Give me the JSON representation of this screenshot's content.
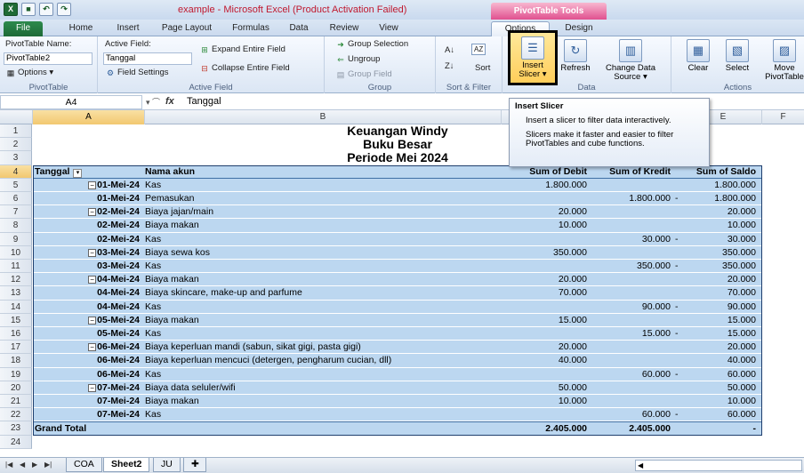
{
  "window": {
    "title": "example - Microsoft Excel (Product Activation Failed)",
    "context_tab_group": "PivotTable Tools"
  },
  "tabs": [
    "File",
    "Home",
    "Insert",
    "Page Layout",
    "Formulas",
    "Data",
    "Review",
    "View",
    "Options",
    "Design"
  ],
  "ribbon": {
    "pivottable": {
      "name_label": "PivotTable Name:",
      "name_value": "PivotTable2",
      "options_label": "Options",
      "group_label": "PivotTable"
    },
    "active_field": {
      "label": "Active Field:",
      "value": "Tanggal",
      "field_settings": "Field Settings",
      "expand": "Expand Entire Field",
      "collapse": "Collapse Entire Field",
      "group_label": "Active Field"
    },
    "group": {
      "selection": "Group Selection",
      "ungroup": "Ungroup",
      "group_field": "Group Field",
      "group_label": "Group"
    },
    "sort": {
      "sort_label": "Sort",
      "group_label": "Sort & Filter"
    },
    "insert_slicer": {
      "line1": "Insert",
      "line2": "Slicer"
    },
    "data": {
      "refresh": "Refresh",
      "change_source1": "Change Data",
      "change_source2": "Source",
      "group_label": "Data"
    },
    "actions": {
      "clear": "Clear",
      "select": "Select",
      "move1": "Move",
      "move2": "PivotTable",
      "group_label": "Actions"
    }
  },
  "formula_bar": {
    "name_box": "A4",
    "fx": "fx",
    "content": "Tanggal"
  },
  "tooltip": {
    "title": "Insert Slicer",
    "body1": "Insert a slicer to filter data interactively.",
    "body2": "Slicers make it faster and easier to filter PivotTables and cube functions."
  },
  "columns": [
    "A",
    "B",
    "C",
    "D",
    "E",
    "F"
  ],
  "sheet_titles": [
    "Keuangan Windy",
    "Buku Besar",
    "Periode Mei 2024"
  ],
  "pivot_header": {
    "tanggal": "Tanggal",
    "nama_akun": "Nama akun",
    "debit": "Sum of Debit",
    "kredit": "Sum of Kredit",
    "saldo": "Sum of Saldo"
  },
  "rows": [
    {
      "n": "5",
      "date": "01-Mei-24",
      "exp": true,
      "akun": "Kas",
      "debit": "1.800.000",
      "kredit": "",
      "dash": "",
      "saldo": "1.800.000"
    },
    {
      "n": "6",
      "date": "01-Mei-24",
      "exp": false,
      "akun": "Pemasukan",
      "debit": "",
      "kredit": "1.800.000",
      "dash": "-",
      "saldo": "1.800.000"
    },
    {
      "n": "7",
      "date": "02-Mei-24",
      "exp": true,
      "akun": "Biaya jajan/main",
      "debit": "20.000",
      "kredit": "",
      "dash": "",
      "saldo": "20.000"
    },
    {
      "n": "8",
      "date": "02-Mei-24",
      "exp": false,
      "akun": "Biaya makan",
      "debit": "10.000",
      "kredit": "",
      "dash": "",
      "saldo": "10.000"
    },
    {
      "n": "9",
      "date": "02-Mei-24",
      "exp": false,
      "akun": "Kas",
      "debit": "",
      "kredit": "30.000",
      "dash": "-",
      "saldo": "30.000"
    },
    {
      "n": "10",
      "date": "03-Mei-24",
      "exp": true,
      "akun": "Biaya sewa kos",
      "debit": "350.000",
      "kredit": "",
      "dash": "",
      "saldo": "350.000"
    },
    {
      "n": "11",
      "date": "03-Mei-24",
      "exp": false,
      "akun": "Kas",
      "debit": "",
      "kredit": "350.000",
      "dash": "-",
      "saldo": "350.000"
    },
    {
      "n": "12",
      "date": "04-Mei-24",
      "exp": true,
      "akun": "Biaya makan",
      "debit": "20.000",
      "kredit": "",
      "dash": "",
      "saldo": "20.000"
    },
    {
      "n": "13",
      "date": "04-Mei-24",
      "exp": false,
      "akun": "Biaya skincare, make-up and parfume",
      "debit": "70.000",
      "kredit": "",
      "dash": "",
      "saldo": "70.000"
    },
    {
      "n": "14",
      "date": "04-Mei-24",
      "exp": false,
      "akun": "Kas",
      "debit": "",
      "kredit": "90.000",
      "dash": "-",
      "saldo": "90.000"
    },
    {
      "n": "15",
      "date": "05-Mei-24",
      "exp": true,
      "akun": "Biaya makan",
      "debit": "15.000",
      "kredit": "",
      "dash": "",
      "saldo": "15.000"
    },
    {
      "n": "16",
      "date": "05-Mei-24",
      "exp": false,
      "akun": "Kas",
      "debit": "",
      "kredit": "15.000",
      "dash": "-",
      "saldo": "15.000"
    },
    {
      "n": "17",
      "date": "06-Mei-24",
      "exp": true,
      "akun": "Biaya keperluan mandi (sabun, sikat gigi, pasta gigi)",
      "debit": "20.000",
      "kredit": "",
      "dash": "",
      "saldo": "20.000"
    },
    {
      "n": "18",
      "date": "06-Mei-24",
      "exp": false,
      "akun": "Biaya keperluan mencuci (detergen, pengharum cucian, dll)",
      "debit": "40.000",
      "kredit": "",
      "dash": "",
      "saldo": "40.000"
    },
    {
      "n": "19",
      "date": "06-Mei-24",
      "exp": false,
      "akun": "Kas",
      "debit": "",
      "kredit": "60.000",
      "dash": "-",
      "saldo": "60.000"
    },
    {
      "n": "20",
      "date": "07-Mei-24",
      "exp": true,
      "akun": "Biaya data seluler/wifi",
      "debit": "50.000",
      "kredit": "",
      "dash": "",
      "saldo": "50.000"
    },
    {
      "n": "21",
      "date": "07-Mei-24",
      "exp": false,
      "akun": "Biaya makan",
      "debit": "10.000",
      "kredit": "",
      "dash": "",
      "saldo": "10.000"
    },
    {
      "n": "22",
      "date": "07-Mei-24",
      "exp": false,
      "akun": "Kas",
      "debit": "",
      "kredit": "60.000",
      "dash": "-",
      "saldo": "60.000"
    }
  ],
  "grand_total": {
    "label": "Grand Total",
    "debit": "2.405.000",
    "kredit": "2.405.000",
    "saldo": "-"
  },
  "sheet_tabs": [
    "COA",
    "Sheet2",
    "JU"
  ]
}
